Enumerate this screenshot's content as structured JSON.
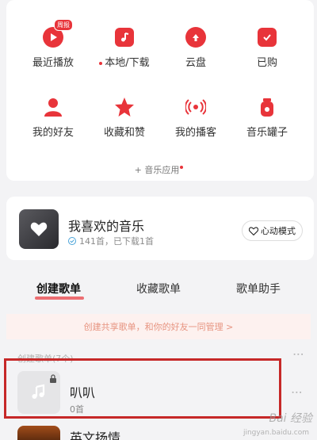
{
  "grid": [
    {
      "label": "最近播放",
      "icon": "play-icon",
      "badge": "周报"
    },
    {
      "label": "本地/下载",
      "icon": "local-music-icon",
      "dot": true
    },
    {
      "label": "云盘",
      "icon": "cloud-upload-icon"
    },
    {
      "label": "已购",
      "icon": "purchased-bag-icon"
    },
    {
      "label": "我的好友",
      "icon": "friends-icon"
    },
    {
      "label": "收藏和赞",
      "icon": "star-icon"
    },
    {
      "label": "我的播客",
      "icon": "podcast-icon"
    },
    {
      "label": "音乐罐子",
      "icon": "music-jar-icon"
    }
  ],
  "music_apps": "+ 音乐应用",
  "favorite": {
    "title": "我喜欢的音乐",
    "subtitle": "141首，已下载1首",
    "heart_mode": "心动模式"
  },
  "tabs": [
    "创建歌单",
    "收藏歌单",
    "歌单助手"
  ],
  "share_hint": "创建共享歌单，和你的好友一同管理 >",
  "section_label": "创建歌单(7个)",
  "playlist": {
    "title": "叭叭",
    "count": "0首"
  },
  "next_playlist": {
    "title": "英文扬情"
  },
  "watermark": {
    "text": "Bai 经验",
    "sub": "jingyan.baidu.com"
  },
  "colors": {
    "accent": "#e8343a",
    "highlight": "#c62828"
  }
}
